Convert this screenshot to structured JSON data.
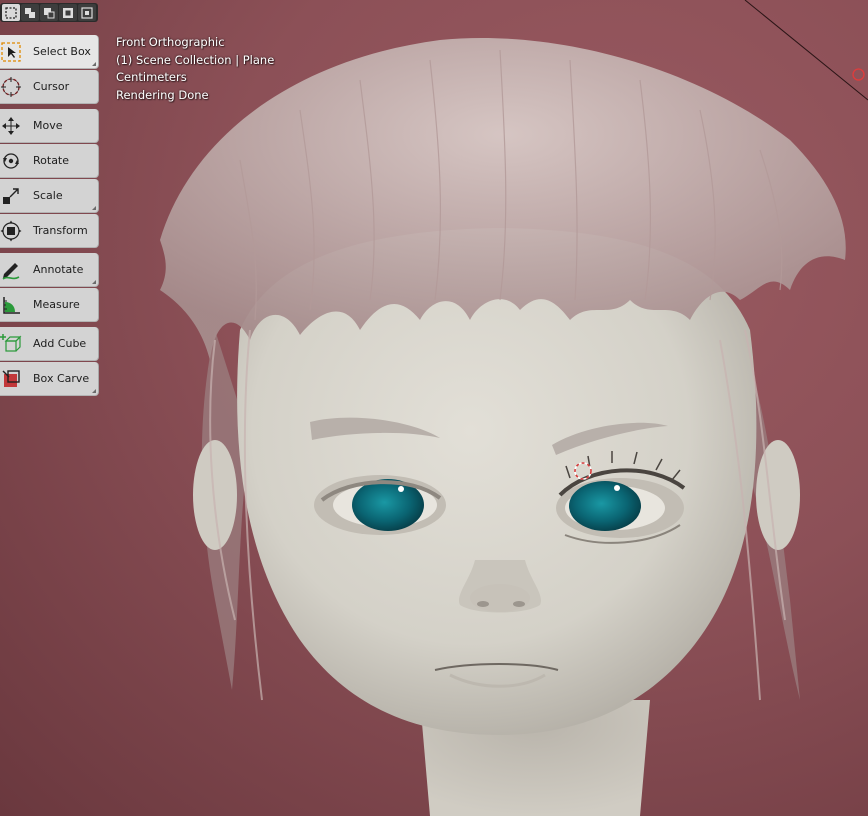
{
  "viewport": {
    "info_lines": [
      "Front Orthographic",
      "(1) Scene Collection | Plane",
      "Centimeters",
      "Rendering Done"
    ]
  },
  "header": {
    "select_modes": [
      {
        "icon": "select-mode-box-icon"
      },
      {
        "icon": "select-mode-extend-icon"
      },
      {
        "icon": "select-mode-subtract-icon"
      },
      {
        "icon": "select-mode-invert-icon"
      },
      {
        "icon": "select-mode-intersect-icon"
      }
    ]
  },
  "toolbar": {
    "groups": [
      [
        {
          "label": "Select Box",
          "icon": "select-box-icon",
          "active": true
        },
        {
          "label": "Cursor",
          "icon": "cursor-icon",
          "active": false
        }
      ],
      [
        {
          "label": "Move",
          "icon": "move-icon",
          "active": false
        },
        {
          "label": "Rotate",
          "icon": "rotate-icon",
          "active": false
        },
        {
          "label": "Scale",
          "icon": "scale-icon",
          "active": false
        },
        {
          "label": "Transform",
          "icon": "transform-icon",
          "active": false
        }
      ],
      [
        {
          "label": "Annotate",
          "icon": "annotate-icon",
          "active": false
        },
        {
          "label": "Measure",
          "icon": "measure-icon",
          "active": false
        }
      ],
      [
        {
          "label": "Add Cube",
          "icon": "add-cube-icon",
          "active": false
        },
        {
          "label": "Box Carve",
          "icon": "box-carve-icon",
          "active": false
        }
      ]
    ]
  },
  "colors": {
    "background": "#8c5057",
    "tool_bg": "#d3d3d3",
    "tool_active_bg": "#e6e6e6",
    "skin": "#d8d5cc",
    "iris": "#0b6e7c",
    "hair": "#c9b7b5"
  }
}
